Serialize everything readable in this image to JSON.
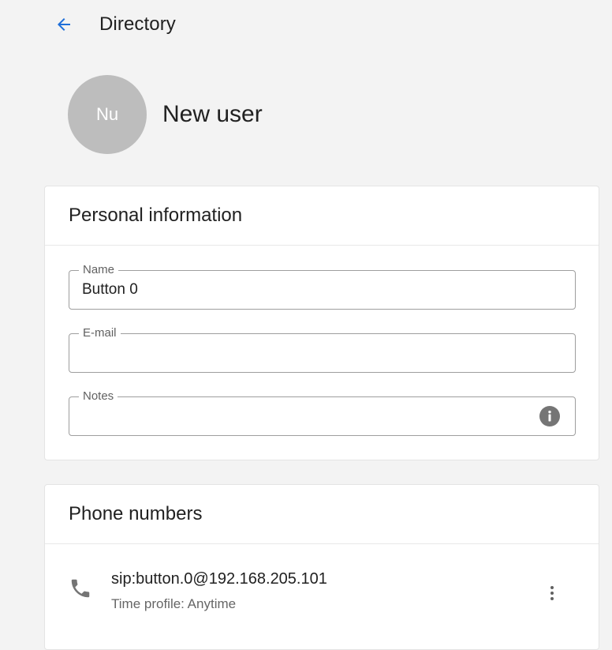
{
  "header": {
    "back_icon": "arrow-left-icon",
    "title": "Directory"
  },
  "user": {
    "initials": "Nu",
    "name": "New user",
    "avatar_color": "#bdbdbd"
  },
  "personal_info": {
    "title": "Personal information",
    "fields": [
      {
        "label": "Name",
        "value": "Button 0"
      },
      {
        "label": "E-mail",
        "value": ""
      },
      {
        "label": "Notes",
        "value": "",
        "icon": "info-icon"
      }
    ]
  },
  "phone_numbers": {
    "title": "Phone numbers",
    "items": [
      {
        "icon": "phone-icon",
        "address": "sip:button.0@192.168.205.101",
        "time_profile": "Time profile: Anytime",
        "menu_icon": "more-vertical-icon"
      }
    ]
  },
  "colors": {
    "accent": "#1e6fd9",
    "background": "#f3f3f3",
    "card": "#ffffff"
  }
}
